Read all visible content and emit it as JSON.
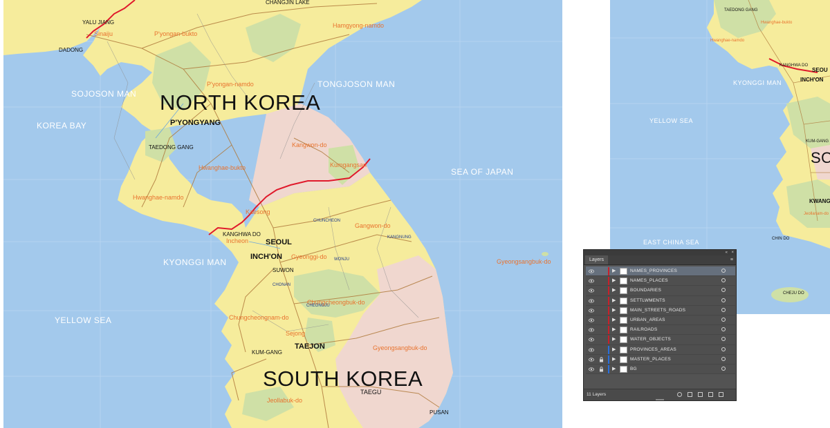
{
  "main_map": {
    "countries": [
      "NORTH KOREA",
      "SOUTH KOREA"
    ],
    "seas": [
      "SOJOSON MAN",
      "TONGJOSON MAN",
      "KOREA BAY",
      "SEA OF JAPAN",
      "KYONGGI MAN",
      "YELLOW SEA"
    ],
    "provinces": [
      "Sinaiju",
      "P'yongan-bukto",
      "Hamgyong-namdo",
      "P'yongan-namdo",
      "Kangwon-do",
      "Hwanghae-bukto",
      "Kumgangsan",
      "Hwanghae-namdo",
      "Kaesong",
      "Gangwon-do",
      "Incheon",
      "Gyeonggi-do",
      "Gyeongsangbuk-do",
      "Chungcheongbuk-do",
      "Chungcheongnam-do",
      "Sejong",
      "Gyeongsangbuk-do",
      "Jeollabuk-do"
    ],
    "cities": [
      "P'YONGYANG",
      "SEOUL",
      "INCH'ON",
      "TAEJON",
      "TAEGU",
      "SUWON",
      "KANGHWA DO",
      "CHANGJIN LAKE"
    ],
    "towns": [
      "YALU JIANG",
      "DADONG",
      "TAEDONG GANG",
      "KUM-GANG",
      "PUSAN",
      "CHUNCHEON",
      "KANGNUNG",
      "WONJU",
      "CHONAN",
      "CHEONGJU"
    ]
  },
  "side_map": {
    "seas": [
      "KYONGGI MAN",
      "YELLOW SEA",
      "EAST CHINA SEA"
    ],
    "places": [
      "TAEDONG GANG",
      "Hwanghae-bukto",
      "Hwanghae-namdo",
      "KANGHWA DO",
      "SEOU",
      "INCH'ON",
      "KUM-GANG",
      "KWANG",
      "Jeollanam-do",
      "CHIN DO",
      "CHEJU DO",
      "SO"
    ]
  },
  "layers_panel": {
    "tab_label": "Layers",
    "layer_count_label": "11 Layers",
    "header_buttons": [
      "«",
      "×"
    ],
    "menu_icon": "≡",
    "layers": [
      {
        "name": "NAMES_PROVINCES",
        "selected": true,
        "locked": false,
        "color": "#c8202a"
      },
      {
        "name": "NAMES_PLACES",
        "selected": false,
        "locked": false,
        "color": "#c8202a"
      },
      {
        "name": "BOUNDARIES",
        "selected": false,
        "locked": false,
        "color": "#c8202a"
      },
      {
        "name": "SETTLWMENTS",
        "selected": false,
        "locked": false,
        "color": "#c8202a"
      },
      {
        "name": "MAIN_STREETS_ROADS",
        "selected": false,
        "locked": false,
        "color": "#c8202a"
      },
      {
        "name": "URBAN_AREAS",
        "selected": false,
        "locked": false,
        "color": "#c8202a"
      },
      {
        "name": "RAILROADS",
        "selected": false,
        "locked": false,
        "color": "#c8202a"
      },
      {
        "name": "WATER_OBJECTS",
        "selected": false,
        "locked": false,
        "color": "#c8202a"
      },
      {
        "name": "PROVINCES_AREAS",
        "selected": false,
        "locked": false,
        "color": "#2a6fdc"
      },
      {
        "name": "MASTER_PLACES",
        "selected": false,
        "locked": true,
        "color": "#2a6fdc"
      },
      {
        "name": "BG",
        "selected": false,
        "locked": true,
        "color": "#2a6fdc"
      }
    ]
  },
  "colors": {
    "sea": "#a3c9ec",
    "land_yellow": "#f6ec9c",
    "land_green": "#cfe0a6",
    "land_pink": "#f0d7cf",
    "border_red": "#e0192b",
    "road": "#b07a3c"
  }
}
